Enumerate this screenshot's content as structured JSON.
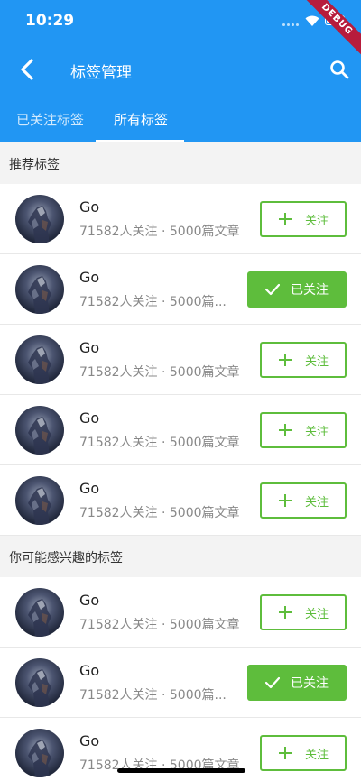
{
  "status": {
    "time": "10:29",
    "debug_label": "DEBUG"
  },
  "header": {
    "title": "标签管理"
  },
  "tabs": [
    {
      "label": "已关注标签",
      "active": false
    },
    {
      "label": "所有标签",
      "active": true
    }
  ],
  "sections": [
    {
      "title": "推荐标签",
      "items": [
        {
          "name": "Go",
          "meta": "71582人关注 · 5000篇文章",
          "followed": false,
          "button": "关注"
        },
        {
          "name": "Go",
          "meta": "71582人关注 · 5000篇...",
          "followed": true,
          "button": "已关注"
        },
        {
          "name": "Go",
          "meta": "71582人关注 · 5000篇文章",
          "followed": false,
          "button": "关注"
        },
        {
          "name": "Go",
          "meta": "71582人关注 · 5000篇文章",
          "followed": false,
          "button": "关注"
        },
        {
          "name": "Go",
          "meta": "71582人关注 · 5000篇文章",
          "followed": false,
          "button": "关注"
        }
      ]
    },
    {
      "title": "你可能感兴趣的标签",
      "items": [
        {
          "name": "Go",
          "meta": "71582人关注 · 5000篇文章",
          "followed": false,
          "button": "关注"
        },
        {
          "name": "Go",
          "meta": "71582人关注 · 5000篇...",
          "followed": true,
          "button": "已关注"
        },
        {
          "name": "Go",
          "meta": "71582人关注 · 5000篇文章",
          "followed": false,
          "button": "关注"
        }
      ]
    }
  ],
  "colors": {
    "primary": "#2196f3",
    "accent_green": "#5ebd3c",
    "section_bg": "#f3f3f3"
  },
  "icons": {
    "back": "chevron-left-icon",
    "search": "search-icon",
    "follow": "plus-icon",
    "followed": "check-icon"
  }
}
